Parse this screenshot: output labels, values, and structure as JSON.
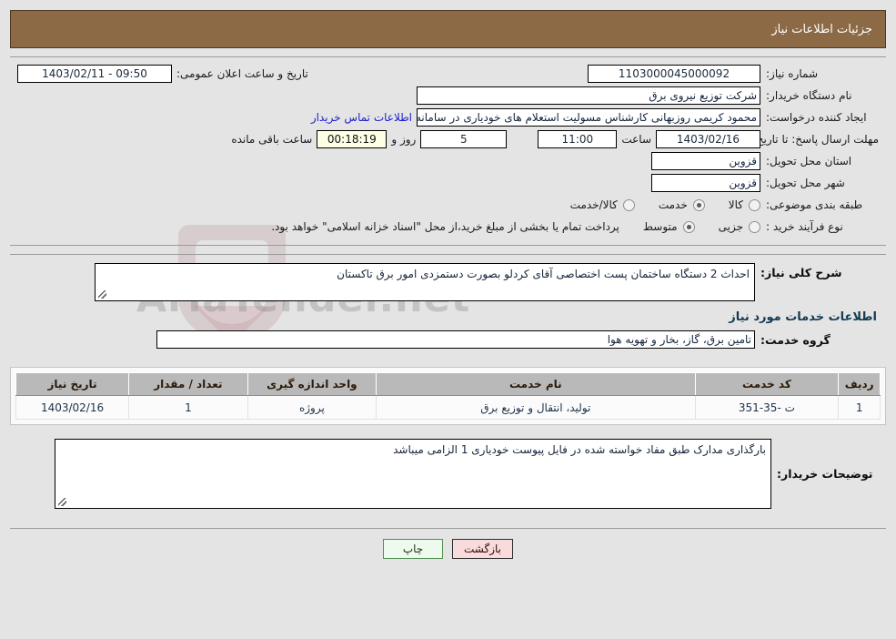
{
  "header": {
    "title": "جزئیات اطلاعات نیاز"
  },
  "form": {
    "need_number_label": "شماره نیاز:",
    "need_number_value": "1103000045000092",
    "public_announce_label": "تاریخ و ساعت اعلان عمومی:",
    "public_announce_value": "1403/02/11 - 09:50",
    "buyer_org_label": "نام دستگاه خریدار:",
    "buyer_org_value": "شرکت توزیع نیروی برق",
    "creator_label": "ایجاد کننده درخواست:",
    "creator_value": "محمود کریمی روزبهانی کارشناس  مسولیت استعلام های خودیاری در سامانه ت",
    "contact_link": "اطلاعات تماس خریدار",
    "deadline_label": "مهلت ارسال پاسخ: تا تاریخ:",
    "deadline_date": "1403/02/16",
    "hour_label": "ساعت",
    "hour_value": "11:00",
    "days_value": "5",
    "days_label": "روز و",
    "timer_value": "00:18:19",
    "timer_label": "ساعت باقی مانده",
    "province_label": "استان محل تحویل:",
    "province_value": "قزوین",
    "city_label": "شهر محل تحویل:",
    "city_value": "قزوین",
    "category_label": "طبقه بندی موضوعی:",
    "category_options": [
      {
        "label": "کالا",
        "selected": false
      },
      {
        "label": "خدمت",
        "selected": true
      },
      {
        "label": "کالا/خدمت",
        "selected": false
      }
    ],
    "process_label": "نوع فرآیند خرید :",
    "process_options": [
      {
        "label": "جزیی",
        "selected": false
      },
      {
        "label": "متوسط",
        "selected": true
      }
    ],
    "process_note": "پرداخت تمام یا بخشی از مبلغ خرید،از محل \"اسناد خزانه اسلامی\" خواهد بود."
  },
  "description": {
    "label": "شرح کلی نیاز:",
    "value": "احداث 2 دستگاه ساختمان پست اختصاصی آقای کردلو بصورت دستمزدی امور برق تاکستان"
  },
  "services_section": {
    "title": "اطلاعات خدمات مورد نیاز",
    "group_label": "گروه خدمت:",
    "group_value": "تامین برق، گاز، بخار و تهویه هوا"
  },
  "table": {
    "columns": [
      "ردیف",
      "کد خدمت",
      "نام خدمت",
      "واحد اندازه گیری",
      "تعداد / مقدار",
      "تاریخ نیاز"
    ],
    "rows": [
      {
        "index": "1",
        "code": "ت -35-351",
        "name": "تولید، انتقال و توزیع برق",
        "unit": "پروژه",
        "quantity": "1",
        "date": "1403/02/16"
      }
    ]
  },
  "buyer_notes": {
    "label": "توضیحات خریدار:",
    "value": "بارگذاری مدارک طبق مفاد خواسته شده در فایل پیوست خودیاری 1 الزامی میباشد"
  },
  "buttons": {
    "print": "چاپ",
    "back": "بازگشت"
  },
  "watermark": {
    "text": "AriaTender.net",
    "dots": "••••"
  }
}
